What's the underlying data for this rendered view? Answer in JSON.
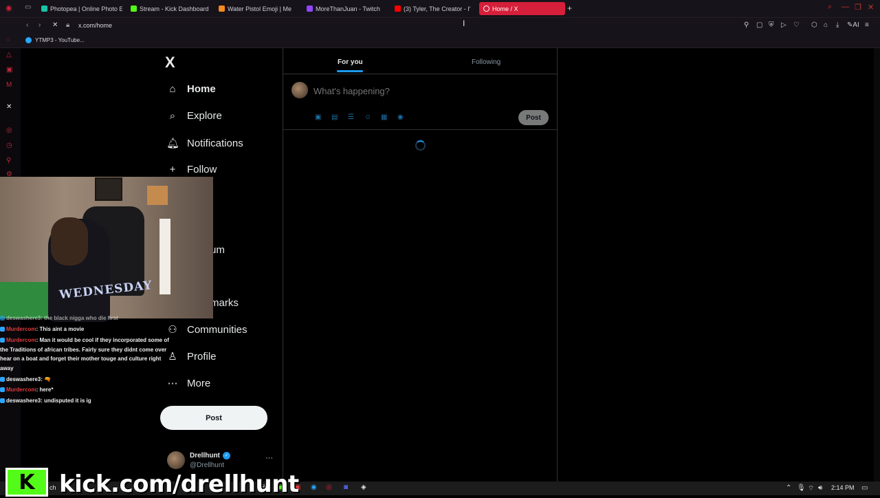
{
  "browser": {
    "tabs": [
      {
        "label": "Photopea | Online Photo E",
        "color": "#19c4a6"
      },
      {
        "label": "Stream - Kick Dashboard",
        "color": "#53fc18"
      },
      {
        "label": "Water Pistol Emoji | Me",
        "color": "#f58a1f"
      },
      {
        "label": "MoreThanJuan - Twitch",
        "color": "#9146ff"
      },
      {
        "label": "(3) Tyler, The Creator - I'",
        "color": "#ff0000"
      },
      {
        "label": "Home / X",
        "color": "#ffffff"
      }
    ],
    "new_tab": "+",
    "url": "x.com/home",
    "bookmark": "YTMP3 - YouTube..."
  },
  "x": {
    "logo": "X",
    "nav": [
      {
        "label": "Home",
        "icon": "home-icon",
        "glyph": "⌂"
      },
      {
        "label": "Explore",
        "icon": "search-icon",
        "glyph": "⌕"
      },
      {
        "label": "Notifications",
        "icon": "bell-icon",
        "glyph": "♪"
      },
      {
        "label": "Follow",
        "icon": "follow-icon",
        "glyph": "+"
      },
      {
        "label": "um",
        "icon": "premium-icon",
        "glyph": ""
      },
      {
        "label": "marks",
        "icon": "bookmarks-icon",
        "glyph": ""
      },
      {
        "label": "Communities",
        "icon": "communities-icon",
        "glyph": "⚇"
      },
      {
        "label": "Profile",
        "icon": "profile-icon",
        "glyph": "♙"
      },
      {
        "label": "More",
        "icon": "more-icon",
        "glyph": "⋯"
      }
    ],
    "post_button": "Post",
    "profile": {
      "name": "Drellhunt",
      "handle": "@Drellhunt",
      "verified": "✓",
      "more": "···"
    },
    "tabs": {
      "for_you": "For you",
      "following": "Following"
    },
    "composer": {
      "placeholder": "What's happening?",
      "post": "Post"
    }
  },
  "stream": {
    "shirt_text": "WEDNESDAY",
    "chat": [
      {
        "user": "deswashere3",
        "msg": ": the black nigga who die first",
        "user_color": "#f2f2f2"
      },
      {
        "user": "Murdercom",
        "msg": ": This aint a movie",
        "user_color": "#e23b3b"
      },
      {
        "user": "Murdercom",
        "msg": ": Man it would be cool if they incorporated some of the Traditions of african tribes. Fairly sure they didnt come over hear on a boat and forget their mother touge and culture right away",
        "user_color": "#e23b3b"
      },
      {
        "user": "deswashere3",
        "msg": ": 🔫",
        "user_color": "#f2f2f2"
      },
      {
        "user": "Murdercom",
        "msg": ": here*",
        "user_color": "#e23b3b"
      },
      {
        "user": "deswashere3",
        "msg": ": undisputed it is ig",
        "user_color": "#f2f2f2"
      }
    ],
    "kick_logo": "K",
    "kick_url": "kick.com/drellhunt"
  },
  "taskbar": {
    "clock": "2:14 PM",
    "search_partial": "ch"
  }
}
